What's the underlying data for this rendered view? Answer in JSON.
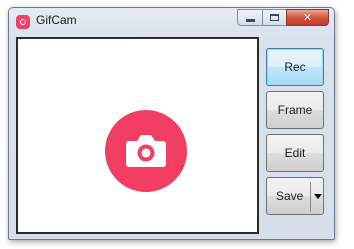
{
  "window": {
    "title": "GifCam",
    "app_icon": "camera-icon"
  },
  "caption_buttons": {
    "minimize_icon": "minimize-icon",
    "maximize_icon": "maximize-icon",
    "close_icon": "close-icon",
    "close_glyph": "✕"
  },
  "canvas": {
    "icon": "camera-icon",
    "accent_color": "#f23e63"
  },
  "buttons": {
    "rec": "Rec",
    "frame": "Frame",
    "edit": "Edit",
    "save": "Save"
  },
  "save_menu_icon": "chevron-down-icon"
}
